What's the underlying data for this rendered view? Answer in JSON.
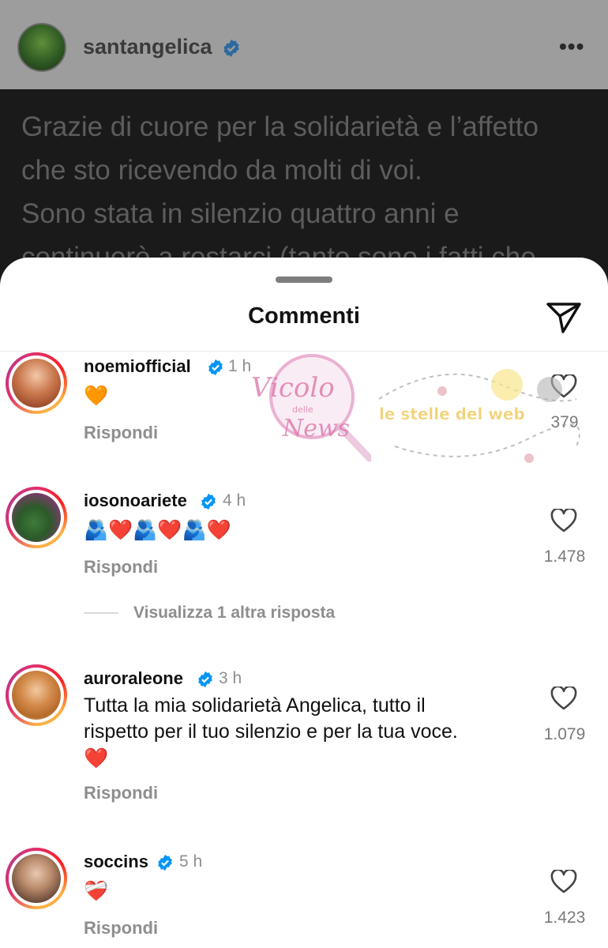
{
  "post": {
    "username": "santangelica",
    "lines": [
      "Grazie di cuore per la solidarietà e l’affetto",
      "che sto ricevendo da molti di voi.",
      "Sono stata in silenzio quattro anni e",
      "continuerò a restarci (tanto sono i fatti che"
    ]
  },
  "sheet": {
    "title": "Commenti"
  },
  "comments": [
    {
      "username": "noemiofficial",
      "time": "1 h",
      "text": "🧡",
      "reply": "Rispondi",
      "likes": "379"
    },
    {
      "username": "iosonoariete",
      "time": "4 h",
      "text": "🫂❤️🫂❤️🫂❤️",
      "reply": "Rispondi",
      "likes": "1.478"
    },
    {
      "username": "auroraleone",
      "time": "3 h",
      "text_line1": "Tutta la mia solidarietà Angelica, tutto il",
      "text_line2": "rispetto per il tuo silenzio e per la tua voce.",
      "text_line3": "❤️",
      "reply": "Rispondi",
      "likes": "1.079"
    },
    {
      "username": "soccins",
      "time": "5 h",
      "text": "❤️‍🩹",
      "reply": "Rispondi",
      "likes": "1.423"
    }
  ],
  "view_more": "Visualizza 1 altra risposta",
  "watermarks": {
    "left": "Vicolo delle News",
    "right": "le stelle del web"
  },
  "colors": {
    "verified": "#0095f6",
    "accent_gradient": "#e1306c"
  }
}
